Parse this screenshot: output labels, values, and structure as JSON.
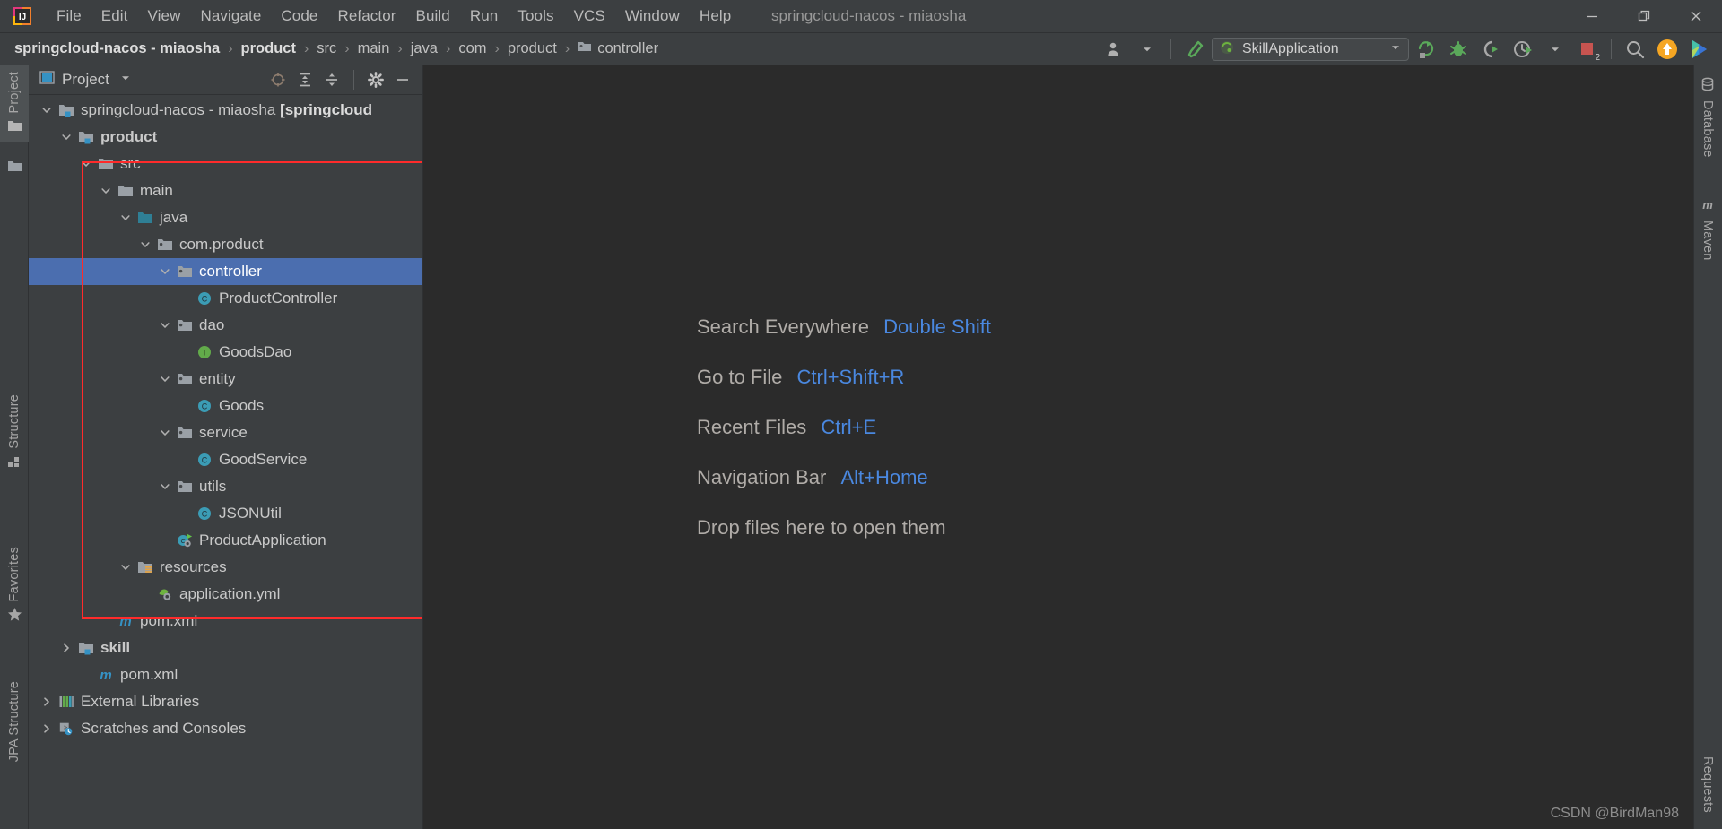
{
  "window": {
    "title": "springcloud-nacos - miaosha",
    "controls": [
      {
        "name": "minimize",
        "glyph": "minimize-icon"
      },
      {
        "name": "maximize",
        "glyph": "restore-icon"
      },
      {
        "name": "close",
        "glyph": "close-icon"
      }
    ]
  },
  "menubar": {
    "logo": "intellij-idea-logo",
    "items": [
      {
        "label": "File",
        "mnemonic": "F"
      },
      {
        "label": "Edit",
        "mnemonic": "E"
      },
      {
        "label": "View",
        "mnemonic": "V"
      },
      {
        "label": "Navigate",
        "mnemonic": "N"
      },
      {
        "label": "Code",
        "mnemonic": "C"
      },
      {
        "label": "Refactor",
        "mnemonic": "R"
      },
      {
        "label": "Build",
        "mnemonic": "B"
      },
      {
        "label": "Run",
        "mnemonic": "u"
      },
      {
        "label": "Tools",
        "mnemonic": "T"
      },
      {
        "label": "VCS",
        "mnemonic": "S"
      },
      {
        "label": "Window",
        "mnemonic": "W"
      },
      {
        "label": "Help",
        "mnemonic": "H"
      }
    ]
  },
  "navbar": {
    "breadcrumbs": [
      {
        "label": "springcloud-nacos - miaosha",
        "bold": true,
        "icon": null
      },
      {
        "label": "product",
        "bold": true,
        "icon": null
      },
      {
        "label": "src",
        "bold": false,
        "icon": null
      },
      {
        "label": "main",
        "bold": false,
        "icon": null
      },
      {
        "label": "java",
        "bold": false,
        "icon": null
      },
      {
        "label": "com",
        "bold": false,
        "icon": null
      },
      {
        "label": "product",
        "bold": false,
        "icon": null
      },
      {
        "label": "controller",
        "bold": false,
        "icon": "package-icon"
      }
    ],
    "separator": "›",
    "run_config": {
      "name": "SkillApplication",
      "icon": "spring-boot-icon",
      "dropdown": "chevron-down-icon"
    },
    "icons": [
      {
        "name": "user-avatar-icon"
      },
      {
        "name": "chevron-down-icon"
      },
      {
        "name": "build-hammer-icon"
      },
      {
        "name": "run-icon"
      },
      {
        "name": "debug-icon"
      },
      {
        "name": "run-with-coverage-icon"
      },
      {
        "name": "profiler-icon"
      },
      {
        "name": "chevron-down-icon"
      },
      {
        "name": "stop-icon"
      },
      {
        "name": "search-icon"
      },
      {
        "name": "update-project-icon"
      },
      {
        "name": "idea-assistant-icon"
      }
    ],
    "stop_badge": "2"
  },
  "stripe_left": {
    "top": [
      {
        "label": "Project",
        "icon": "project-folder-icon",
        "selected": true
      },
      {
        "label": "",
        "icon": "folder-icon",
        "selected": false
      }
    ],
    "bottom": [
      {
        "label": "Structure",
        "icon": "structure-icon"
      },
      {
        "label": "Favorites",
        "icon": "star-icon"
      },
      {
        "label": "JPA Structure",
        "icon": "jpa-icon"
      }
    ]
  },
  "stripe_right": {
    "items": [
      {
        "label": "Database",
        "icon": "database-icon"
      },
      {
        "label": "Maven",
        "icon": "maven-icon"
      },
      {
        "label": "Requests",
        "icon": "requests-icon"
      }
    ]
  },
  "project_panel": {
    "title": "Project",
    "view_selector_icon": "chevron-down-icon",
    "tools": [
      {
        "name": "select-opened-file-icon"
      },
      {
        "name": "expand-all-icon"
      },
      {
        "name": "collapse-all-icon"
      },
      {
        "name": "settings-gear-icon"
      },
      {
        "name": "hide-panel-icon"
      }
    ]
  },
  "tree": {
    "nodes": [
      {
        "label": "springcloud-nacos - miaosha [springcloud",
        "indent": 0,
        "arrow": "expanded",
        "icon": "module-icon",
        "bold": false,
        "bold_suffix": true,
        "selected": false
      },
      {
        "label": "product",
        "indent": 1,
        "arrow": "expanded",
        "icon": "module-icon",
        "bold": true,
        "selected": false
      },
      {
        "label": "src",
        "indent": 2,
        "arrow": "expanded",
        "icon": "folder-icon",
        "bold": false,
        "selected": false
      },
      {
        "label": "main",
        "indent": 3,
        "arrow": "expanded",
        "icon": "folder-icon",
        "bold": false,
        "selected": false
      },
      {
        "label": "java",
        "indent": 4,
        "arrow": "expanded",
        "icon": "source-root-icon",
        "bold": false,
        "selected": false
      },
      {
        "label": "com.product",
        "indent": 5,
        "arrow": "expanded",
        "icon": "package-icon",
        "bold": false,
        "selected": false
      },
      {
        "label": "controller",
        "indent": 6,
        "arrow": "expanded",
        "icon": "package-icon",
        "bold": false,
        "selected": true
      },
      {
        "label": "ProductController",
        "indent": 7,
        "arrow": "none",
        "icon": "class-icon",
        "bold": false,
        "selected": false
      },
      {
        "label": "dao",
        "indent": 6,
        "arrow": "expanded",
        "icon": "package-icon",
        "bold": false,
        "selected": false
      },
      {
        "label": "GoodsDao",
        "indent": 7,
        "arrow": "none",
        "icon": "interface-icon",
        "bold": false,
        "selected": false
      },
      {
        "label": "entity",
        "indent": 6,
        "arrow": "expanded",
        "icon": "package-icon",
        "bold": false,
        "selected": false
      },
      {
        "label": "Goods",
        "indent": 7,
        "arrow": "none",
        "icon": "class-icon",
        "bold": false,
        "selected": false
      },
      {
        "label": "service",
        "indent": 6,
        "arrow": "expanded",
        "icon": "package-icon",
        "bold": false,
        "selected": false
      },
      {
        "label": "GoodService",
        "indent": 7,
        "arrow": "none",
        "icon": "class-icon",
        "bold": false,
        "selected": false
      },
      {
        "label": "utils",
        "indent": 6,
        "arrow": "expanded",
        "icon": "package-icon",
        "bold": false,
        "selected": false
      },
      {
        "label": "JSONUtil",
        "indent": 7,
        "arrow": "none",
        "icon": "class-icon",
        "bold": false,
        "selected": false
      },
      {
        "label": "ProductApplication",
        "indent": 6,
        "arrow": "none",
        "icon": "spring-boot-class-icon",
        "bold": false,
        "selected": false
      },
      {
        "label": "resources",
        "indent": 4,
        "arrow": "expanded",
        "icon": "resources-root-icon",
        "bold": false,
        "selected": false
      },
      {
        "label": "application.yml",
        "indent": 5,
        "arrow": "none",
        "icon": "spring-config-icon",
        "bold": false,
        "selected": false
      },
      {
        "label": "pom.xml",
        "indent": 3,
        "arrow": "none",
        "icon": "maven-pom-icon",
        "bold": false,
        "selected": false
      },
      {
        "label": "skill",
        "indent": 1,
        "arrow": "collapsed",
        "icon": "module-icon",
        "bold": true,
        "selected": false
      },
      {
        "label": "pom.xml",
        "indent": 2,
        "arrow": "none",
        "icon": "maven-pom-icon",
        "bold": false,
        "selected": false
      },
      {
        "label": "External Libraries",
        "indent": 0,
        "arrow": "collapsed",
        "icon": "libraries-icon",
        "bold": false,
        "selected": false
      },
      {
        "label": "Scratches and Consoles",
        "indent": 0,
        "arrow": "collapsed",
        "icon": "scratches-icon",
        "bold": false,
        "selected": false
      }
    ],
    "highlight_color": "#ff2b2b"
  },
  "editor": {
    "hints": [
      {
        "name": "Search Everywhere",
        "key": "Double Shift"
      },
      {
        "name": "Go to File",
        "key": "Ctrl+Shift+R"
      },
      {
        "name": "Recent Files",
        "key": "Ctrl+E"
      },
      {
        "name": "Navigation Bar",
        "key": "Alt+Home"
      },
      {
        "name": "Drop files here to open them",
        "key": ""
      }
    ],
    "watermark": "CSDN @BirdMan98"
  },
  "colors": {
    "background": "#3c3f41",
    "editor_background": "#2b2b2b",
    "selection": "#4b6eaf",
    "accent_blue": "#4a88e0",
    "text": "#c9c9c9",
    "highlight_red": "#ff2b2b",
    "folder_gray": "#9aa0a6",
    "source_root_teal": "#3c8b9e"
  }
}
